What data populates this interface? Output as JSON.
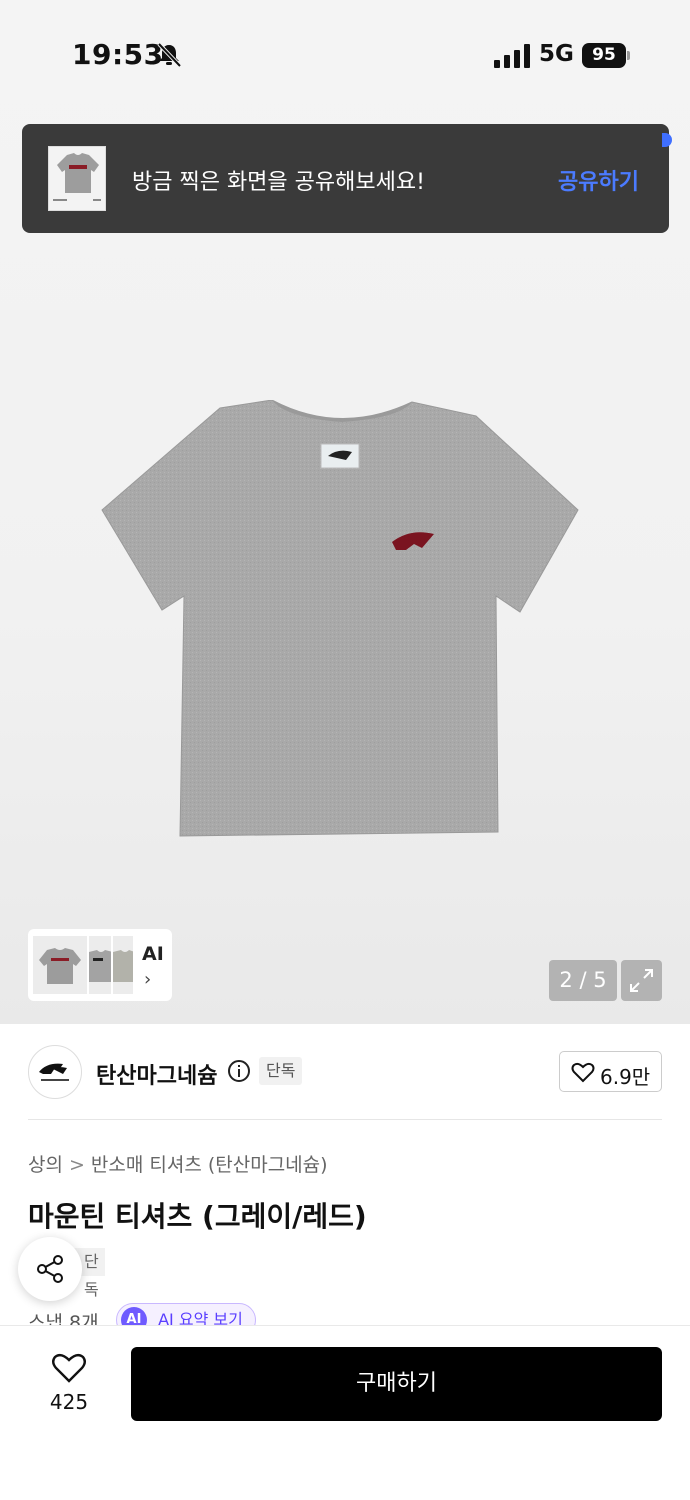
{
  "status_bar": {
    "time": "19:53",
    "network": "5G",
    "battery": "95",
    "icons": [
      "bell-slash-icon",
      "signal-icon",
      "battery-icon"
    ]
  },
  "toast": {
    "message": "방금 찍은 화면을 공유해보세요!",
    "action": "공유하기",
    "action_color": "#4b7bff"
  },
  "gallery": {
    "current": "2 / 5",
    "thumb_label": "AI",
    "thumb_chevron": "›",
    "expand_icon": "expand-icon"
  },
  "brand": {
    "name": "탄산마그네슘",
    "badge": "단독",
    "likes": "6.9만"
  },
  "product": {
    "breadcrumb": [
      "상의",
      "반소매 티셔츠 (탄산마그네슘)"
    ],
    "breadcrumb_separator": ">",
    "title": "마운틴 티셔츠 (그레이/레드)",
    "tag": "단독",
    "review_count": "스냅 8개",
    "ai_badge": "AI",
    "ai_summary_label": "AI 요약 보기"
  },
  "bottom_bar": {
    "heart_count": "425",
    "buy_label": "구매하기"
  },
  "colors": {
    "accent": "#4b7bff",
    "buy_button": "#000000",
    "ai_purple": "#6f5bff",
    "logo_red": "#7a1420"
  }
}
